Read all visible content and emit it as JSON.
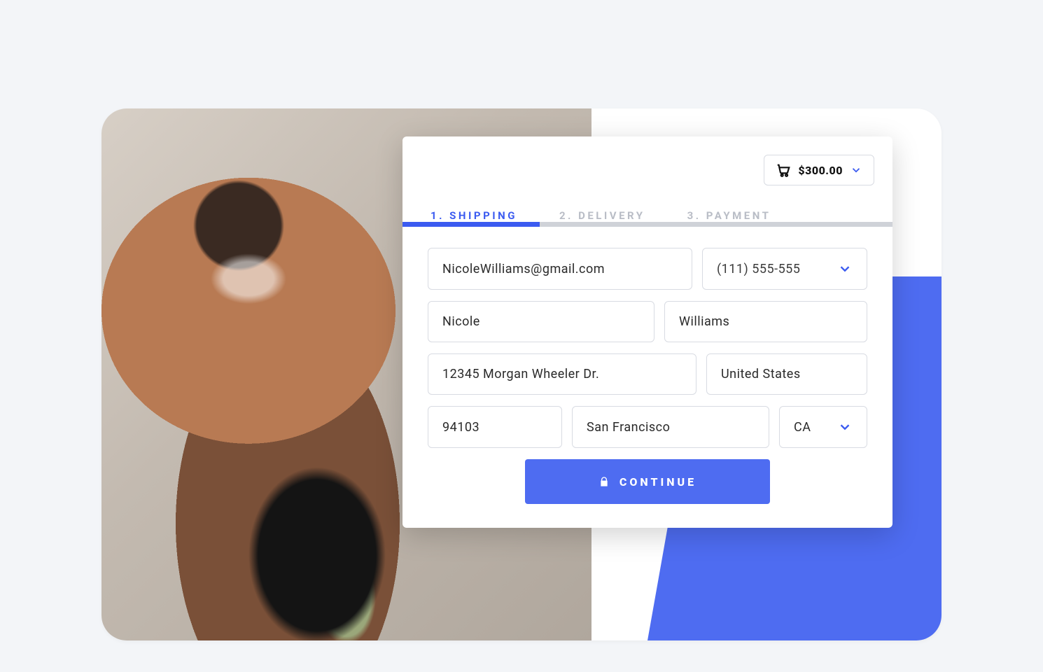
{
  "cart": {
    "total": "$300.00"
  },
  "steps": {
    "s1": "1. SHIPPING",
    "s2": "2. DELIVERY",
    "s3": "3. PAYMENT"
  },
  "form": {
    "email": "NicoleWilliams@gmail.com",
    "phone": "(111) 555-555",
    "first_name": "Nicole",
    "last_name": "Williams",
    "address": "12345 Morgan Wheeler Dr.",
    "country": "United States",
    "zip": "94103",
    "city": "San Francisco",
    "state": "CA"
  },
  "cta": {
    "label": "CONTINUE"
  }
}
